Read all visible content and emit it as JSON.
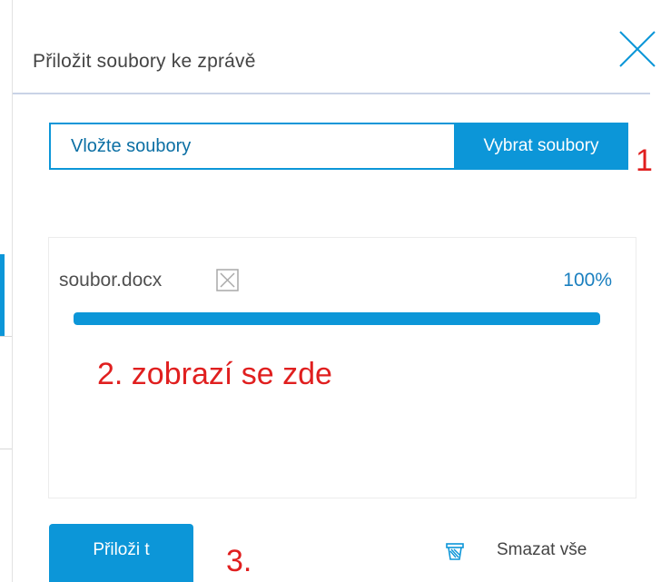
{
  "dialog": {
    "title": "Přiložit soubory ke zprávě"
  },
  "upload": {
    "drop_placeholder": "Vložte soubory",
    "choose_label": "Vybrat soubory"
  },
  "files": [
    {
      "name": "soubor.docx",
      "progress_text": "100%",
      "progress": 1.0
    }
  ],
  "footer": {
    "attach_label": "Přiloži t",
    "clear_all_label": "Smazat vše"
  },
  "annotations": {
    "step1": "1",
    "step2": "2. zobrazí se zde",
    "step3": "3."
  },
  "icons": {
    "close": "close-x-icon",
    "remove_file": "remove-file-icon",
    "clear_all": "trash-icon"
  },
  "colors": {
    "accent": "#0c96d8",
    "annotation": "#e01f1f",
    "header_line": "#c9d3e6"
  }
}
